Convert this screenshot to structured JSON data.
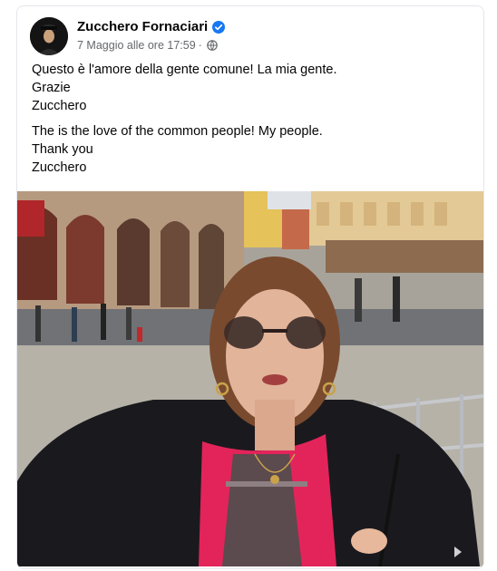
{
  "post": {
    "author": "Zucchero Fornaciari",
    "verified": true,
    "date": "7 Maggio alle ore 17:59",
    "separator": "·",
    "privacy_icon": "globe-icon",
    "text_italian": [
      "Questo è l'amore della gente comune! La mia gente.",
      "Grazie",
      "Zucchero"
    ],
    "text_english": [
      "The is the love of the common people! My people.",
      "Thank you",
      "Zucchero"
    ]
  },
  "colors": {
    "verified_blue": "#1877f2",
    "meta_gray": "#65676b",
    "scarf_pink": "#e3245a"
  },
  "media": {
    "type": "video",
    "description_icon": "video-player"
  }
}
